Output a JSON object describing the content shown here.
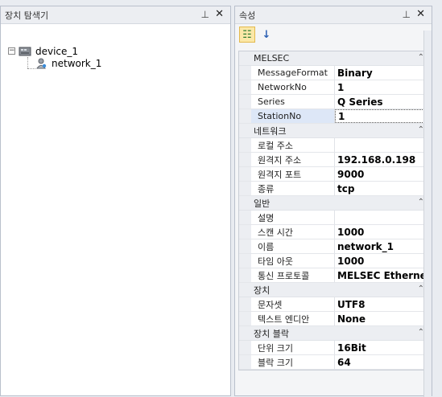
{
  "explorer": {
    "title": "장치 탐색기",
    "pin_icon": "pin-icon",
    "close_icon": "close-icon",
    "expander_symbol": "−",
    "tree": [
      {
        "label": "device_1",
        "icon": "device-icon"
      },
      {
        "label": "network_1",
        "icon": "network-icon"
      }
    ]
  },
  "properties": {
    "title": "속성",
    "categories": [
      {
        "name": "MELSEC",
        "rows": [
          {
            "name": "MessageFormat",
            "value": "Binary"
          },
          {
            "name": "NetworkNo",
            "value": "1"
          },
          {
            "name": "Series",
            "value": "Q Series"
          },
          {
            "name": "StationNo",
            "value": "1",
            "selected": true
          }
        ]
      },
      {
        "name": "네트워크",
        "rows": [
          {
            "name": "로컬 주소",
            "value": ""
          },
          {
            "name": "원격지 주소",
            "value": "192.168.0.198"
          },
          {
            "name": "원격지 포트",
            "value": "9000"
          },
          {
            "name": "종류",
            "value": "tcp"
          }
        ]
      },
      {
        "name": "일반",
        "rows": [
          {
            "name": "설명",
            "value": ""
          },
          {
            "name": "스캔 시간",
            "value": "1000"
          },
          {
            "name": "이름",
            "value": "network_1"
          },
          {
            "name": "타임 아웃",
            "value": "1000"
          },
          {
            "name": "통신 프로토콜",
            "value": "MELSEC Ethernet"
          }
        ]
      },
      {
        "name": "장치",
        "rows": [
          {
            "name": "문자셋",
            "value": "UTF8"
          },
          {
            "name": "텍스트 엔디안",
            "value": "None"
          }
        ]
      },
      {
        "name": "장치 블락",
        "rows": [
          {
            "name": "단위 크기",
            "value": "16Bit"
          },
          {
            "name": "블락 크기",
            "value": "64"
          }
        ]
      }
    ]
  },
  "colors": {
    "selected_row": "#dde7f7",
    "active_tool": "#fbe8a8"
  }
}
